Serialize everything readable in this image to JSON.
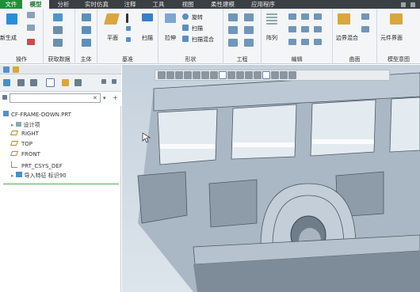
{
  "tabs": [
    "文件",
    "模型",
    "分析",
    "实时仿真",
    "注释",
    "工具",
    "视图",
    "柔性建模",
    "应用程序"
  ],
  "ribbon": {
    "buttons": {
      "regen_partial": "新生成",
      "plane": "平面",
      "sweep": "扫描",
      "rotate": "旋转",
      "extrude": "拉伸",
      "shell_sweep": "扫描",
      "sweep_blend": "扫描混合",
      "pattern": "阵列",
      "boundary_blend": "边界混合",
      "component_interface": "元件界面"
    },
    "groups": {
      "operations": "操作",
      "get_data": "获取数据",
      "body": "主体",
      "datum": "基准",
      "shapes": "形状",
      "engineering": "工程",
      "editing": "编辑",
      "surfaces": "曲面",
      "model_intent": "模型意图"
    }
  },
  "tree": {
    "search_placeholder": "",
    "root": "CF-FRAME-DOWN.PRT",
    "items": [
      "设计项",
      "RIGHT",
      "TOP",
      "FRONT",
      "PRT_CSYS_DEF",
      "导入特征 标识90"
    ]
  },
  "colors": {
    "brand": "#1f8f3a",
    "tabbar": "#3a3f44",
    "ribbon": "#f3f5f7",
    "model": "#b5c1cd"
  }
}
